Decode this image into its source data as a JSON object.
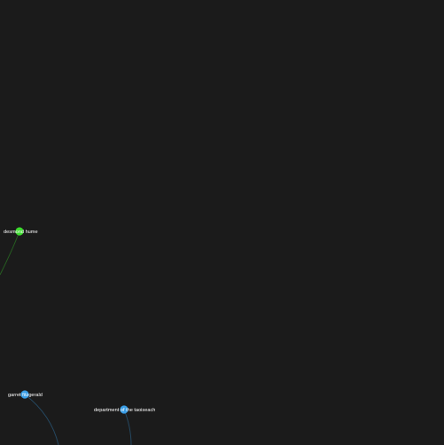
{
  "graph": {
    "background_color": "#1b1b1b",
    "label_color": "#ffffff",
    "nodes": [
      {
        "id": "n1",
        "label": "desmond hume",
        "color": "#3ddc2e",
        "slug": "desmond-hume"
      },
      {
        "id": "n2",
        "label": "garret fitzgerald",
        "color": "#3a9ee6",
        "slug": "garret-fitzgerald"
      },
      {
        "id": "n3",
        "label": "department of the taoiseach",
        "color": "#3a9ee6",
        "slug": "department-of-the-taoiseach"
      }
    ],
    "edges": [
      {
        "source": "n1",
        "target": "offscreen-left",
        "color": "#3ddc2e"
      },
      {
        "source": "n2",
        "target": "offscreen-bottom",
        "color": "#3a9ee6"
      },
      {
        "source": "n3",
        "target": "offscreen-bottom",
        "color": "#3a9ee6"
      }
    ]
  }
}
